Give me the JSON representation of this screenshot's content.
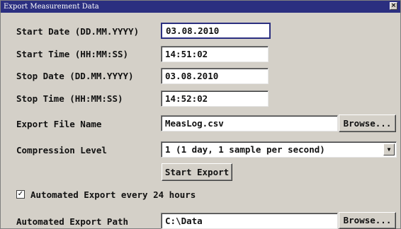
{
  "window": {
    "title": "Export Measurement Data",
    "close_glyph": "×"
  },
  "form": {
    "start_date": {
      "label": "Start Date (DD.MM.YYYY)",
      "value": "03.08.2010"
    },
    "start_time": {
      "label": "Start Time (HH:MM:SS)",
      "value": "14:51:02"
    },
    "stop_date": {
      "label": "Stop Date (DD.MM.YYYY)",
      "value": "03.08.2010"
    },
    "stop_time": {
      "label": "Stop Time (HH:MM:SS)",
      "value": "14:52:02"
    },
    "export_file": {
      "label": "Export File Name",
      "value": "MeasLog.csv",
      "browse_label": "Browse..."
    },
    "compression": {
      "label": "Compression Level",
      "selected": "1 (1 day, 1 sample per second)",
      "arrow_glyph": "▼"
    },
    "start_export_label": "Start Export",
    "auto_export": {
      "checked": true,
      "check_glyph": "✓",
      "label": "Automated Export every 24 hours"
    },
    "auto_path": {
      "label": "Automated Export Path",
      "value": "C:\\Data",
      "browse_label": "Browse..."
    }
  }
}
